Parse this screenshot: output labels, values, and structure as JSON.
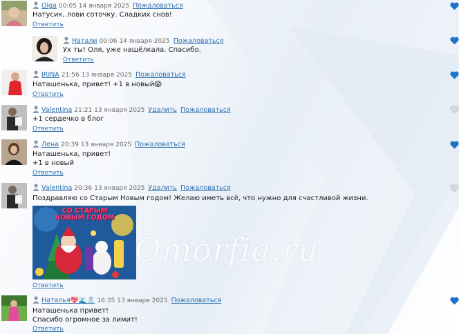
{
  "watermark": "Omorfia.ru",
  "labels": {
    "reply": "Ответить",
    "report": "Пожаловаться",
    "delete": "Удалить"
  },
  "colors": {
    "link": "#2c6fb0",
    "heart_active": "#1e73c8",
    "heart_inactive": "#cfd3d8"
  },
  "comments": [
    {
      "author": "Olga",
      "date": "00:05 14 января 2025",
      "text": [
        "Натусик, лови соточку. Сладких снов!"
      ],
      "liked": true,
      "has_delete": false
    },
    {
      "author": "Натали",
      "date": "00:06 14 января 2025",
      "text": [
        "Ух ты! Оля, уже нащёлкала. Спасибо."
      ],
      "liked": true,
      "has_delete": false,
      "is_reply": true
    },
    {
      "author": "IRINA",
      "date": "21:56 13 января 2025",
      "text": [
        "Наташенька, привет! +1 в новый😱"
      ],
      "liked": true,
      "has_delete": false
    },
    {
      "author": "Valentina",
      "date": "21:21 13 января 2025",
      "text": [
        "+1 сердечко в блог"
      ],
      "liked": false,
      "has_delete": true
    },
    {
      "author": "Лена",
      "date": "20:39 13 января 2025",
      "text": [
        "Наташенька, привет!",
        "+1 в новый"
      ],
      "liked": true,
      "has_delete": false
    },
    {
      "author": "Valentina",
      "date": "20:36 13 января 2025",
      "text": [
        "Поздравляю со Старым Новым годом! Желаю иметь всё, что нужно для счастливой жизни."
      ],
      "liked": false,
      "has_delete": true,
      "card_text": "СО СТАРЫМ НОВЫМ ГОДОМ"
    },
    {
      "author": "Наталья💖🌊🎗",
      "date": "16:35 13 января 2025",
      "text": [
        "Наташенька привет!",
        "Спасибо огромное за лимит!"
      ],
      "liked": true,
      "has_delete": false
    }
  ]
}
